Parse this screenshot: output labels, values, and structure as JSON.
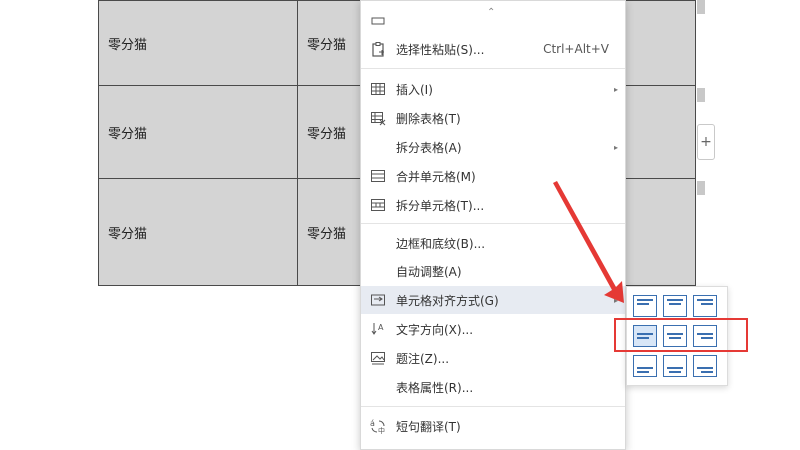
{
  "table": {
    "cells": [
      "零分猫",
      "零分猫",
      "零分猫",
      "零分猫",
      "零分猫",
      "零分猫"
    ]
  },
  "add_button": {
    "label": "+"
  },
  "menu": {
    "items": [
      {
        "label": "",
        "shortcut": "",
        "icon": "cut-icon"
      },
      {
        "label": "选择性粘贴(S)...",
        "shortcut": "Ctrl+Alt+V",
        "icon": "paste-special-icon"
      },
      {
        "label": "插入(I)",
        "icon": "table-insert-icon",
        "arrow": "▸"
      },
      {
        "label": "删除表格(T)",
        "icon": "table-delete-icon"
      },
      {
        "label": "拆分表格(A)",
        "arrow": "▸"
      },
      {
        "label": "合并单元格(M)",
        "icon": "merge-cells-icon"
      },
      {
        "label": "拆分单元格(T)...",
        "icon": "split-cells-icon"
      },
      {
        "label": "边框和底纹(B)..."
      },
      {
        "label": "自动调整(A)"
      },
      {
        "label": "单元格对齐方式(G)",
        "icon": "cell-align-icon",
        "arrow": "▸"
      },
      {
        "label": "文字方向(X)...",
        "icon": "text-direction-icon"
      },
      {
        "label": "题注(Z)...",
        "icon": "caption-icon"
      },
      {
        "label": "表格属性(R)..."
      },
      {
        "label": "短句翻译(T)",
        "icon": "translate-icon"
      }
    ],
    "scroll_up": "⌃"
  },
  "submenu": {
    "selected": "middle-left",
    "options": [
      "top-left",
      "top-center",
      "top-right",
      "middle-left",
      "middle-center",
      "middle-right",
      "bottom-left",
      "bottom-center",
      "bottom-right"
    ]
  },
  "colors": {
    "accent": "#3a6fb0",
    "annotation": "#e53935",
    "cell_bg": "#d4d4d4"
  }
}
